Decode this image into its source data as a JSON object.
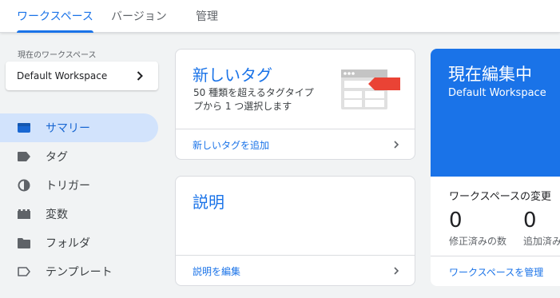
{
  "tabs": [
    {
      "label": "ワークスペース",
      "active": true
    },
    {
      "label": "バージョン",
      "active": false
    },
    {
      "label": "管理",
      "active": false
    }
  ],
  "sidebar": {
    "section_label": "現在のワークスペース",
    "workspace_name": "Default Workspace",
    "items": [
      {
        "label": "サマリー",
        "icon": "summary-icon",
        "active": true
      },
      {
        "label": "タグ",
        "icon": "tag-icon"
      },
      {
        "label": "トリガー",
        "icon": "trigger-icon"
      },
      {
        "label": "変数",
        "icon": "variable-icon"
      },
      {
        "label": "フォルダ",
        "icon": "folder-icon"
      },
      {
        "label": "テンプレート",
        "icon": "template-icon"
      }
    ]
  },
  "new_tag_card": {
    "title": "新しいタグ",
    "description_line1": "50 種類を超えるタグタイプ",
    "description_line2": "プから 1 つ選択します",
    "link": "新しいタグを追加"
  },
  "description_card": {
    "title": "説明",
    "link": "説明を編集"
  },
  "editing_card": {
    "title": "現在編集中",
    "workspace": "Default Workspace",
    "changes_heading": "ワークスペースの変更",
    "stats": [
      {
        "value": "0",
        "label": "修正済みの数"
      },
      {
        "value": "0",
        "label": "追加済み"
      }
    ],
    "link": "ワークスペースを管理"
  },
  "colors": {
    "accent": "#1a73e8",
    "active_nav_bg": "#d2e3fc",
    "tag_red": "#ea4335"
  }
}
